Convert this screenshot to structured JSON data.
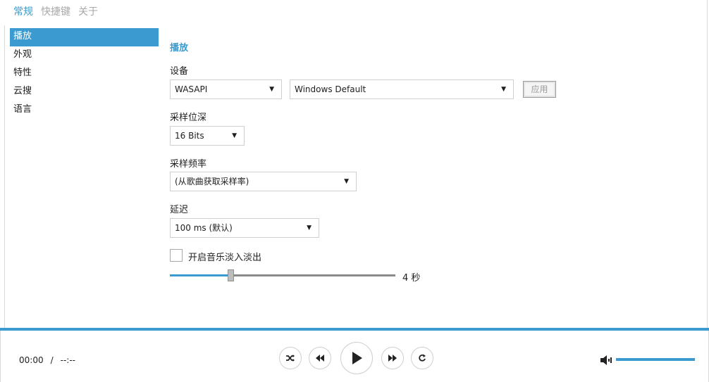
{
  "top_tabs": [
    {
      "label": "常规",
      "active": true
    },
    {
      "label": "快捷键",
      "active": false
    },
    {
      "label": "关于",
      "active": false
    }
  ],
  "sidebar": {
    "items": [
      {
        "label": "播放",
        "active": true
      },
      {
        "label": "外观",
        "active": false
      },
      {
        "label": "特性",
        "active": false
      },
      {
        "label": "云搜",
        "active": false
      },
      {
        "label": "语言",
        "active": false
      }
    ]
  },
  "playback": {
    "section_title": "播放",
    "device": {
      "label": "设备",
      "api_value": "WASAPI",
      "device_value": "Windows Default",
      "apply_label": "应用"
    },
    "bit_depth": {
      "label": "采样位深",
      "value": "16 Bits"
    },
    "sample_rate": {
      "label": "采样频率",
      "value": "(从歌曲获取采样率)"
    },
    "latency": {
      "label": "延迟",
      "value": "100 ms (默认)"
    },
    "fade": {
      "checkbox_label": "开启音乐淡入淡出",
      "checked": false,
      "slider_fraction": 0.27,
      "value_text": "4 秒"
    }
  },
  "player": {
    "current_time": "00:00",
    "separator": "/",
    "total_time": "--:--",
    "controls": [
      {
        "name": "shuffle-button",
        "icon": "shuffle-icon"
      },
      {
        "name": "previous-button",
        "icon": "previous-icon"
      },
      {
        "name": "play-button",
        "icon": "play-icon"
      },
      {
        "name": "next-button",
        "icon": "next-icon"
      },
      {
        "name": "repeat-button",
        "icon": "repeat-icon"
      }
    ],
    "volume_fraction": 1.0
  },
  "colors": {
    "accent": "#3b9bd0",
    "tab_active": "#3d99c9",
    "tab_inactive": "#a8a8a8"
  }
}
